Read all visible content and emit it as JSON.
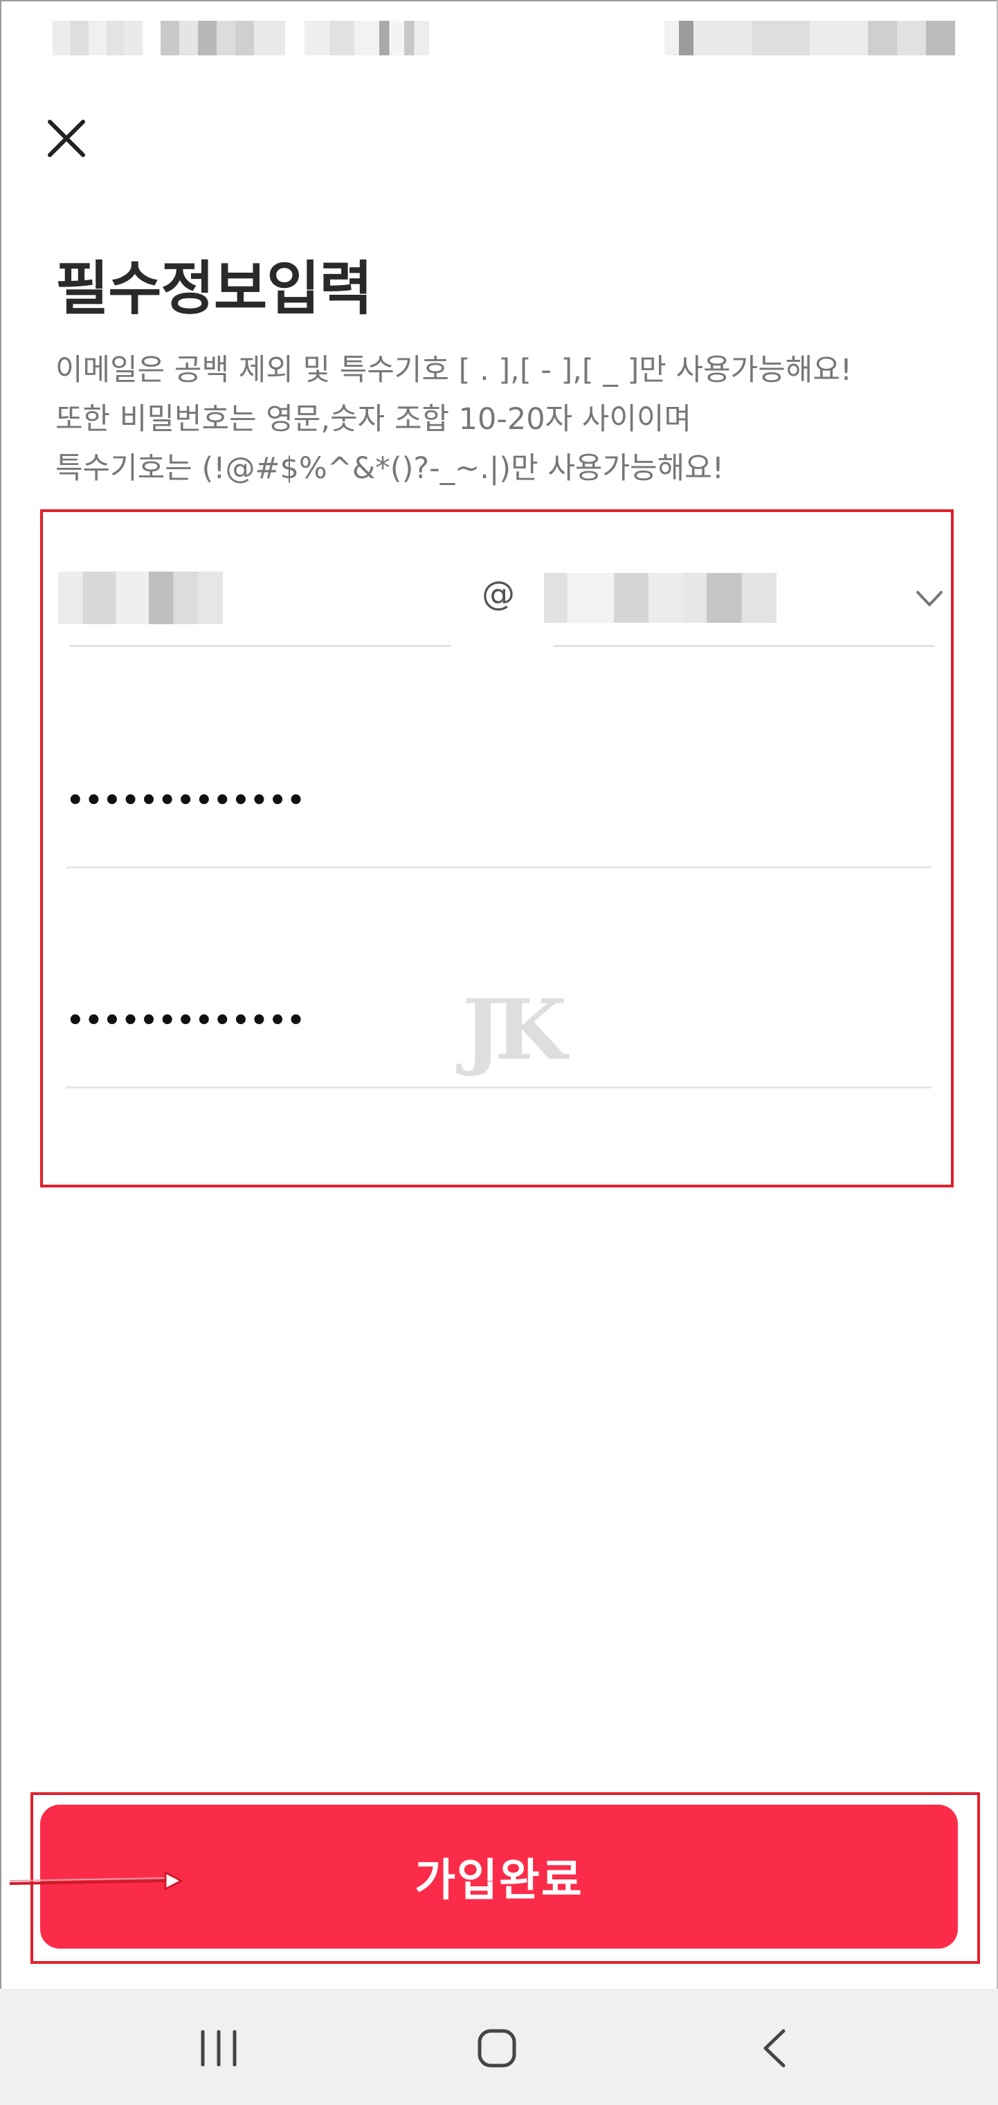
{
  "header": {
    "title": "필수정보입력",
    "description_lines": [
      "이메일은 공백 제외 및 특수기호 [ . ],[ - ],[ _ ]만 사용가능해요!",
      "또한 비밀번호는 영문,숫자 조합 10-20자 사이이며",
      "특수기호는 (!@#$%^&*()?-_~.|)만 사용가능해요!"
    ]
  },
  "form": {
    "email_separator": "@",
    "password_value": "•••••••••••••",
    "password_confirm_value": "•••••••••••••"
  },
  "watermark_text": "JK",
  "submit": {
    "label": "가입완료",
    "color": "#fb2c49"
  },
  "icons": {
    "close": "close-icon",
    "dropdown": "chevron-down-icon",
    "nav_recents": "recents-icon",
    "nav_home": "home-icon",
    "nav_back": "back-icon"
  },
  "colors": {
    "highlight": "#e0202e",
    "nav_bg": "#f0f0f0"
  }
}
